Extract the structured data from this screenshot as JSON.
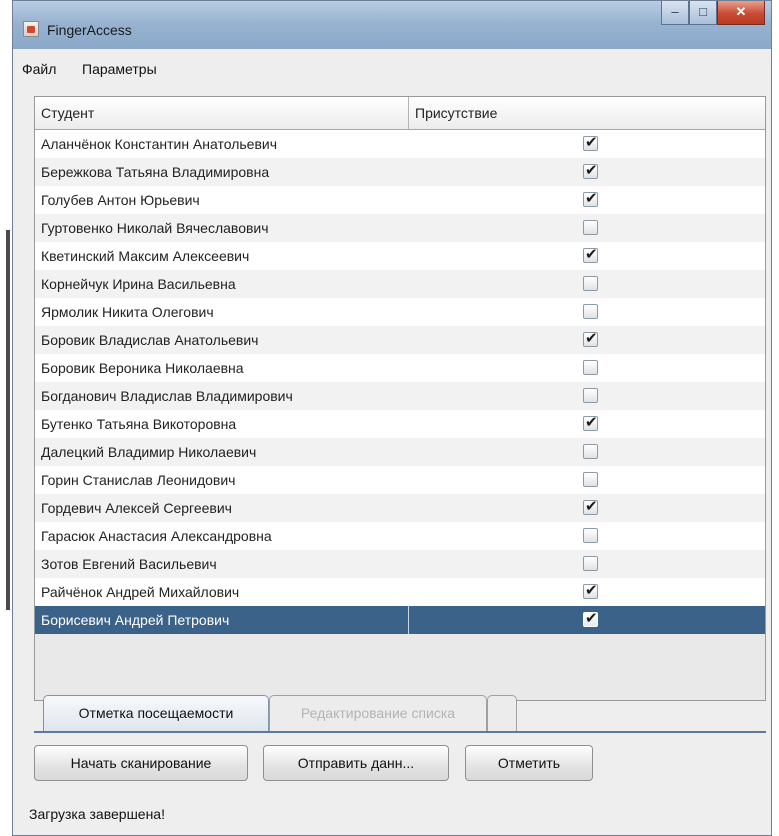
{
  "window": {
    "title": "FingerAccess",
    "controls": {
      "minimize": "–",
      "maximize": "□",
      "close": "✕"
    }
  },
  "menu": [
    "Файл",
    "Параметры"
  ],
  "table": {
    "columns": [
      "Студент",
      "Присутствие"
    ],
    "rows": [
      {
        "name": "Аланчёнок Константин Анатольевич",
        "present": true
      },
      {
        "name": "Бережкова Татьяна Владимировна",
        "present": true
      },
      {
        "name": "Голубев Антон Юрьевич",
        "present": true
      },
      {
        "name": "Гуртовенко Николай Вячеславович",
        "present": false
      },
      {
        "name": "Кветинский Максим Алексеевич",
        "present": true
      },
      {
        "name": "Корнейчук Ирина Васильевна",
        "present": false
      },
      {
        "name": "Ярмолик Никита Олегович",
        "present": false
      },
      {
        "name": "Боровик Владислав Анатольевич",
        "present": true
      },
      {
        "name": "Боровик Вероника Николаевна",
        "present": false
      },
      {
        "name": "Богданович Владислав Владимирович",
        "present": false
      },
      {
        "name": "Бутенко Татьяна Викоторовна",
        "present": true
      },
      {
        "name": "Далецкий Владимир Николаевич",
        "present": false
      },
      {
        "name": "Горин Станислав Леонидович",
        "present": false
      },
      {
        "name": "Гордевич Алексей Сергеевич",
        "present": true
      },
      {
        "name": "Гарасюк Анастасия Александровна",
        "present": false
      },
      {
        "name": "Зотов Евгений Васильевич",
        "present": false
      },
      {
        "name": "Райчёнок Андрей Михайлович",
        "present": true
      },
      {
        "name": "Борисевич Андрей Петрович",
        "present": true,
        "selected": true
      }
    ]
  },
  "tabs": {
    "active": "Отметка посещаемости",
    "inactive": "Редактирование списка"
  },
  "buttons": {
    "start_scan": "Начать сканирование",
    "send_data": "Отправить данн...",
    "mark": "Отметить"
  },
  "status": "Загрузка завершена!",
  "colors": {
    "selection": "#3b6289",
    "titlebar": "#98b3d1",
    "close": "#c94b33"
  },
  "icons": {
    "app": "java-app-icon",
    "check": "checkmark-icon"
  }
}
